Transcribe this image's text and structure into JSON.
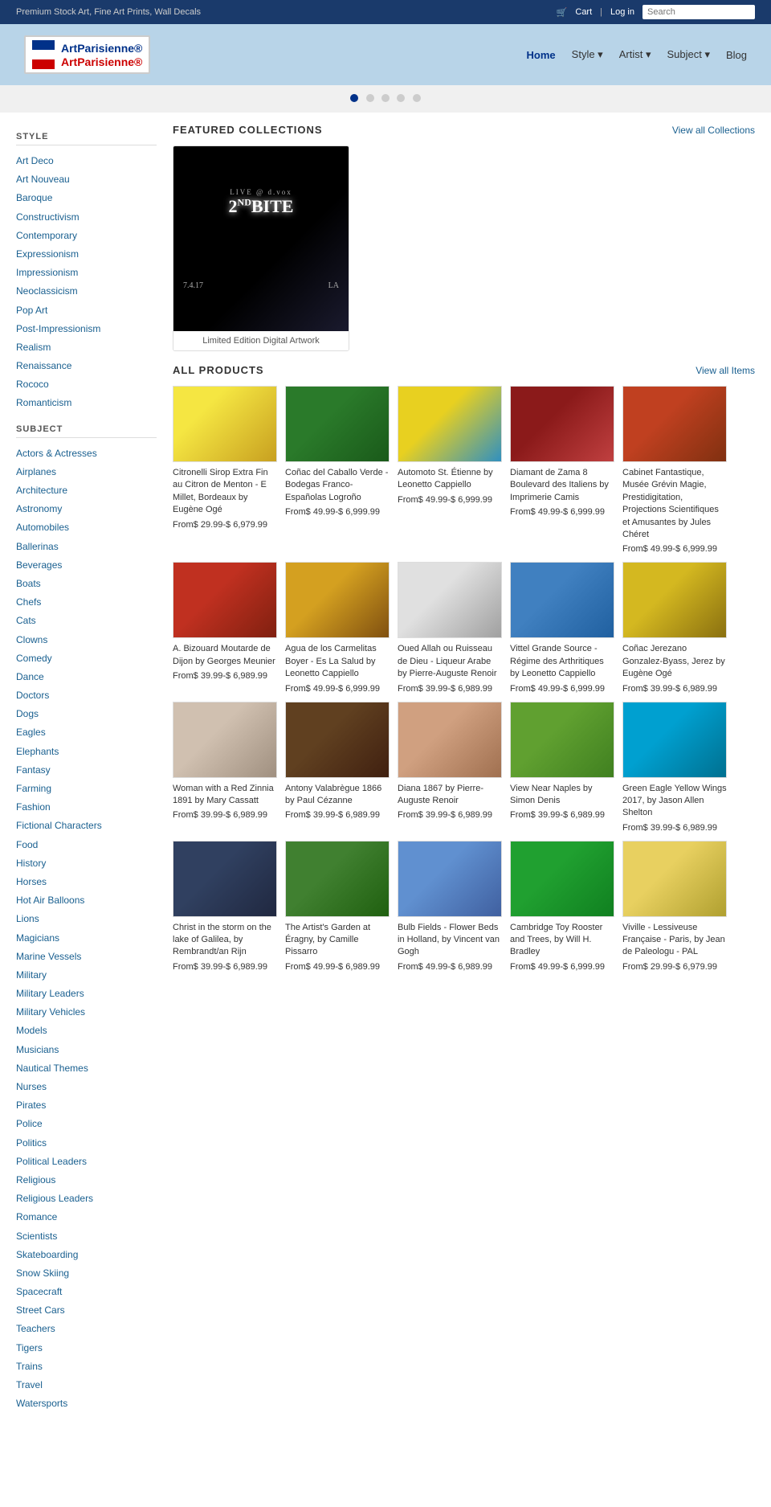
{
  "topbar": {
    "tagline": "Premium Stock Art, Fine Art Prints, Wall Decals",
    "cart": "Cart",
    "login": "Log in",
    "search_placeholder": "Search"
  },
  "header": {
    "logo_text1": "ArtParisienne®",
    "logo_text2": "ArtParisienne®",
    "nav": [
      {
        "label": "Home",
        "active": true,
        "has_dropdown": false
      },
      {
        "label": "Style",
        "active": false,
        "has_dropdown": true
      },
      {
        "label": "Artist",
        "active": false,
        "has_dropdown": true
      },
      {
        "label": "Subject",
        "active": false,
        "has_dropdown": true
      },
      {
        "label": "Blog",
        "active": false,
        "has_dropdown": false
      }
    ]
  },
  "sidebar": {
    "style_title": "STYLE",
    "style_links": [
      "Art Deco",
      "Art Nouveau",
      "Baroque",
      "Constructivism",
      "Contemporary",
      "Expressionism",
      "Impressionism",
      "Neoclassicism",
      "Pop Art",
      "Post-Impressionism",
      "Realism",
      "Renaissance",
      "Rococo",
      "Romanticism"
    ],
    "subject_title": "SUBJECT",
    "subject_links": [
      "Actors & Actresses",
      "Airplanes",
      "Architecture",
      "Astronomy",
      "Automobiles",
      "Ballerinas",
      "Beverages",
      "Boats",
      "Chefs",
      "Cats",
      "Clowns",
      "Comedy",
      "Dance",
      "Doctors",
      "Dogs",
      "Eagles",
      "Elephants",
      "Fantasy",
      "Farming",
      "Fashion",
      "Fictional Characters",
      "Food",
      "History",
      "Horses",
      "Hot Air Balloons",
      "Lions",
      "Magicians",
      "Marine Vessels",
      "Military",
      "Military Leaders",
      "Military Vehicles",
      "Models",
      "Musicians",
      "Nautical Themes",
      "Nurses",
      "Pirates",
      "Police",
      "Politics",
      "Political Leaders",
      "Religious",
      "Religious Leaders",
      "Romance",
      "Scientists",
      "Skateboarding",
      "Snow Skiing",
      "Spacecraft",
      "Street Cars",
      "Teachers",
      "Tigers",
      "Trains",
      "Travel",
      "Watersports"
    ]
  },
  "featured": {
    "title": "FEATURED COLLECTIONS",
    "view_all": "View all Collections",
    "item": {
      "caption": "Limited Edition Digital Artwork",
      "live_text": "LIVE @ d.vox",
      "bite_text": "2nd BITE",
      "date_text": "7.4.17",
      "city_text": "LA"
    }
  },
  "all_products": {
    "title": "ALL PRODUCTS",
    "view_all": "View all Items",
    "products": [
      {
        "id": "citronelli",
        "title": "Citronelli Sirop Extra Fin au Citron de Menton - E Millet, Bordeaux by Eugène Ogé",
        "price": "From$ 29.99-$ 6,979.99",
        "img_class": "img-citronelli"
      },
      {
        "id": "conac",
        "title": "Coñac del Caballo Verde - Bodegas Franco-Españolas Logroño",
        "price": "From$ 49.99-$ 6,999.99",
        "img_class": "img-conac"
      },
      {
        "id": "automoto",
        "title": "Automoto St. Étienne by Leonetto Cappiello",
        "price": "From$ 49.99-$ 6,999.99",
        "img_class": "img-automoto"
      },
      {
        "id": "diamant",
        "title": "Diamant de Zama 8 Boulevard des Italiens by Imprimerie Camis",
        "price": "From$ 49.99-$ 6,999.99",
        "img_class": "img-diamant"
      },
      {
        "id": "cabinet",
        "title": "Cabinet Fantastique, Musée Grévin Magie, Prestidigitation, Projections Scientifiques et Amusantes by Jules Chéret",
        "price": "From$ 49.99-$ 6,999.99",
        "img_class": "img-cabinet"
      },
      {
        "id": "bizouard",
        "title": "A. Bizouard Moutarde de Dijon by Georges Meunier",
        "price": "From$ 39.99-$ 6,989.99",
        "img_class": "img-bizouard"
      },
      {
        "id": "agua",
        "title": "Agua de los Carmelitas Boyer - Es La Salud by Leonetto Cappiello",
        "price": "From$ 49.99-$ 6,999.99",
        "img_class": "img-agua"
      },
      {
        "id": "oued",
        "title": "Oued Allah ou Ruisseau de Dieu - Liqueur Arabe by Pierre-Auguste Renoir",
        "price": "From$ 39.99-$ 6,989.99",
        "img_class": "img-oued"
      },
      {
        "id": "vittel",
        "title": "Vittel Grande Source - Régime des Arthritiques by Leonetto Cappiello",
        "price": "From$ 49.99-$ 6,999.99",
        "img_class": "img-vittel"
      },
      {
        "id": "conac2",
        "title": "Coñac Jerezano Gonzalez-Byass, Jerez by Eugène Ogé",
        "price": "From$ 39.99-$ 6,989.99",
        "img_class": "img-conac2"
      },
      {
        "id": "woman",
        "title": "Woman with a Red Zinnia 1891 by Mary Cassatt",
        "price": "From$ 39.99-$ 6,989.99",
        "img_class": "img-woman"
      },
      {
        "id": "antony",
        "title": "Antony Valabrègue 1866 by Paul Cézanne",
        "price": "From$ 39.99-$ 6,989.99",
        "img_class": "img-antony"
      },
      {
        "id": "diana",
        "title": "Diana 1867 by Pierre-Auguste Renoir",
        "price": "From$ 39.99-$ 6,989.99",
        "img_class": "img-diana"
      },
      {
        "id": "viewnear",
        "title": "View Near Naples by Simon Denis",
        "price": "From$ 39.99-$ 6,989.99",
        "img_class": "img-viewnear"
      },
      {
        "id": "greeneagle",
        "title": "Green Eagle Yellow Wings 2017, by Jason Allen Shelton",
        "price": "From$ 39.99-$ 6,989.99",
        "img_class": "img-greeneagle"
      },
      {
        "id": "christ",
        "title": "Christ in the storm on the lake of Galilea, by Rembrandt/an Rijn",
        "price": "From$ 39.99-$ 6,989.99",
        "img_class": "img-christ"
      },
      {
        "id": "artist",
        "title": "The Artist's Garden at Éragny, by Camille Pissarro",
        "price": "From$ 49.99-$ 6,989.99",
        "img_class": "img-artist"
      },
      {
        "id": "bulb",
        "title": "Bulb Fields - Flower Beds in Holland, by Vincent van Gogh",
        "price": "From$ 49.99-$ 6,989.99",
        "img_class": "img-bulb"
      },
      {
        "id": "cambridge",
        "title": "Cambridge Toy Rooster and Trees, by Will H. Bradley",
        "price": "From$ 49.99-$ 6,999.99",
        "img_class": "img-cambridge"
      },
      {
        "id": "viville",
        "title": "Viville - Lessiveuse Française - Paris, by Jean de Paleologu - PAL",
        "price": "From$ 29.99-$ 6,979.99",
        "img_class": "img-viville"
      }
    ]
  }
}
